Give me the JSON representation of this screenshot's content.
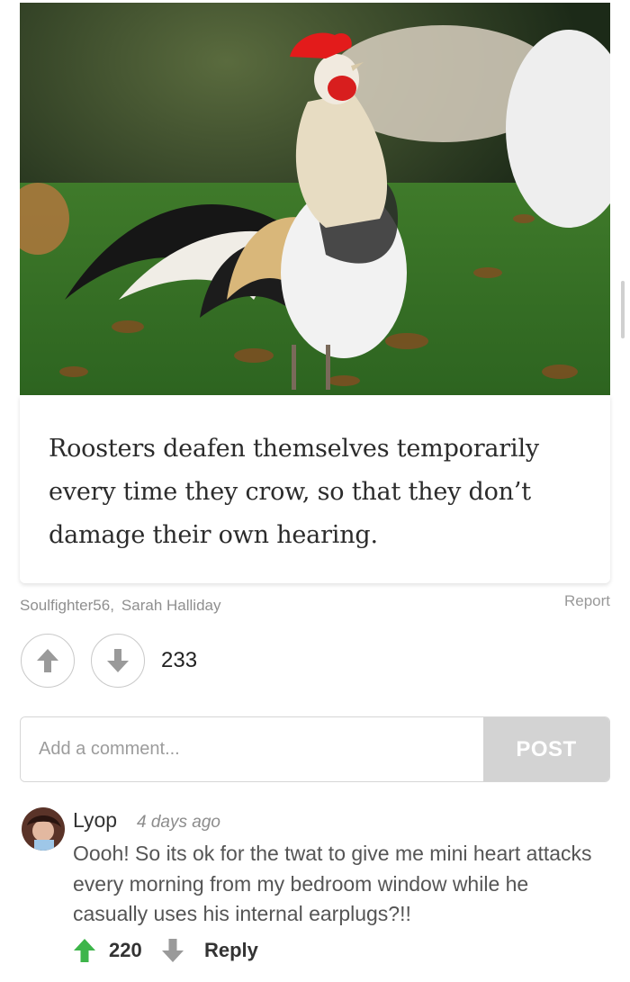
{
  "post": {
    "image_subject": "rooster in grass",
    "fact_text": "Roosters deafen themselves temporarily every time they crow, so that they don’t damage their own hearing.",
    "credits": [
      "Soulfighter56",
      "Sarah Halliday"
    ],
    "credit_separator": ",",
    "report_label": "Report",
    "score": "233"
  },
  "comment_form": {
    "placeholder": "Add a comment...",
    "post_label": "POST"
  },
  "comments": [
    {
      "username": "Lyop",
      "time": "4 days ago",
      "text": "Oooh! So its ok for the twat to give me mini heart attacks every morning from my bedroom window while he casually uses his internal earplugs?!!",
      "score": "220",
      "reply_label": "Reply"
    }
  ],
  "colors": {
    "upvote_green": "#3db54a",
    "vote_gray": "#9a9a9a",
    "post_button": "#d3d3d3"
  }
}
